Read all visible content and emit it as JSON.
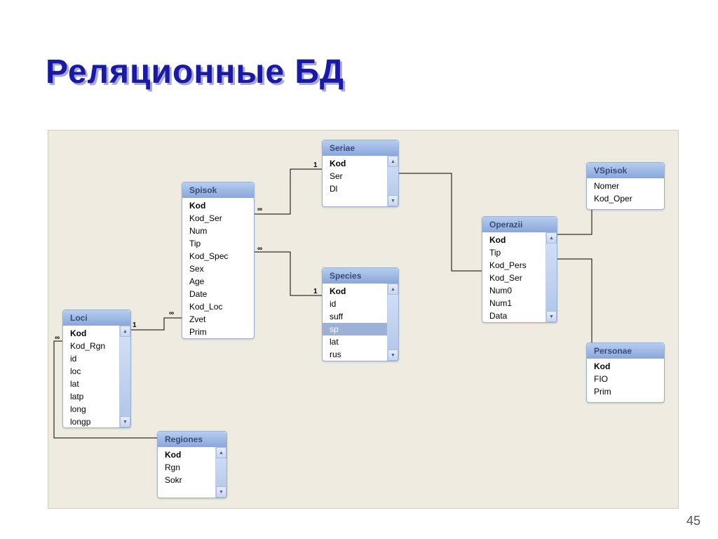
{
  "slide": {
    "title": "Реляционные БД",
    "page_number": "45"
  },
  "tables": {
    "loci": {
      "title": "Loci",
      "fields": [
        "Kod",
        "Kod_Rgn",
        "id",
        "loc",
        "lat",
        "latp",
        "long",
        "longp"
      ],
      "pk": [
        0
      ]
    },
    "spisok": {
      "title": "Spisok",
      "fields": [
        "Kod",
        "Kod_Ser",
        "Num",
        "Tip",
        "Kod_Spec",
        "Sex",
        "Age",
        "Date",
        "Kod_Loc",
        "Zvet",
        "Prim"
      ],
      "pk": [
        0
      ]
    },
    "seriae": {
      "title": "Seriae",
      "fields": [
        "Kod",
        "Ser",
        "Dl"
      ],
      "pk": [
        0
      ]
    },
    "species": {
      "title": "Species",
      "fields": [
        "Kod",
        "id",
        "suff",
        "sp",
        "lat",
        "rus"
      ],
      "pk": [
        0
      ],
      "selected": 3
    },
    "regiones": {
      "title": "Regiones",
      "fields": [
        "Kod",
        "Rgn",
        "Sokr"
      ],
      "pk": [
        0
      ]
    },
    "operazii": {
      "title": "Operazii",
      "fields": [
        "Kod",
        "Tip",
        "Kod_Pers",
        "Kod_Ser",
        "Num0",
        "Num1",
        "Data"
      ],
      "pk": [
        0
      ]
    },
    "vspisok": {
      "title": "VSpisok",
      "fields": [
        "Nomer",
        "Kod_Oper"
      ],
      "pk": []
    },
    "personae": {
      "title": "Personae",
      "fields": [
        "Kod",
        "FIO",
        "Prim"
      ],
      "pk": [
        0
      ]
    }
  },
  "cardinality": {
    "one": "1",
    "many": "∞"
  }
}
